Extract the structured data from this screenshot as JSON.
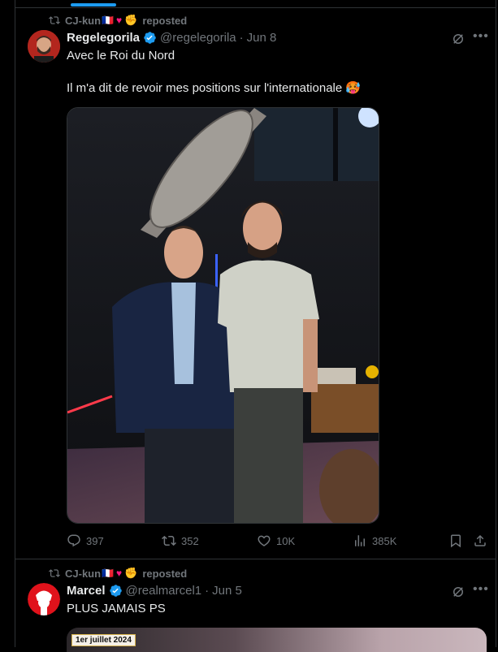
{
  "post1": {
    "repost": {
      "user": "CJ-kun",
      "flag": "🇫🇷",
      "heart": "♥",
      "hand": "✊",
      "label": "reposted"
    },
    "author": {
      "name": "Regelegorila",
      "handle": "@regelegorila",
      "sep": "·",
      "date": "Jun 8"
    },
    "text": "Avec le Roi du Nord\n\nIl m'a dit de revoir mes positions sur l'internationale 🥵",
    "stats": {
      "replies": "397",
      "reposts": "352",
      "likes": "10K",
      "views": "385K"
    }
  },
  "post2": {
    "repost": {
      "user": "CJ-kun",
      "flag": "🇫🇷",
      "heart": "♥",
      "hand": "✊",
      "label": "reposted"
    },
    "author": {
      "name": "Marcel",
      "handle": "@realmarcel1",
      "sep": "·",
      "date": "Jun 5"
    },
    "text": "PLUS JAMAIS PS",
    "media_caption": "1er juillet 2024"
  },
  "icons": {
    "repost": "repost-icon",
    "verified": "verified-badge-icon",
    "grok": "grok-icon",
    "more": "more-icon",
    "reply": "reply-icon",
    "like": "heart-icon",
    "views": "views-icon",
    "bookmark": "bookmark-icon",
    "share": "share-icon"
  },
  "colors": {
    "accent": "#1d9bf0",
    "muted": "#71767b",
    "text": "#e7e9ea",
    "border": "#2f3336"
  }
}
